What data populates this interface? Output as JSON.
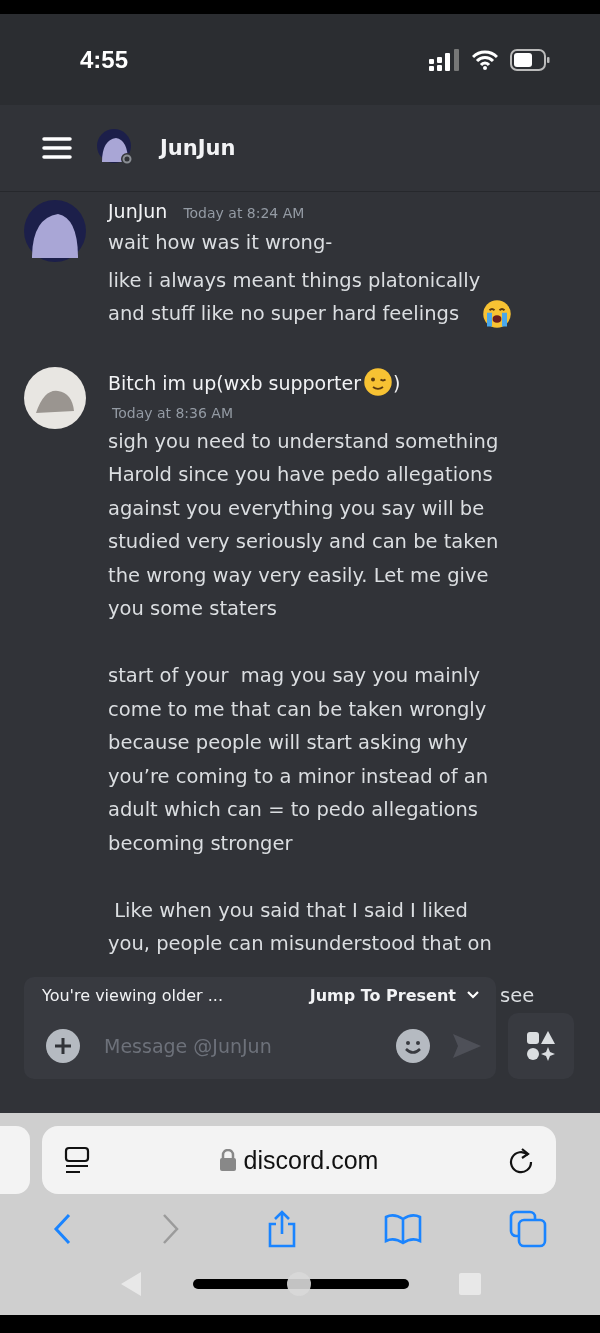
{
  "status_bar": {
    "time": "4:55"
  },
  "header": {
    "title": "JunJun"
  },
  "messages": [
    {
      "author_parts": [
        {
          "kind": "text",
          "text": "JunJun"
        }
      ],
      "timestamp": "Today at 8:24 AM",
      "timestamp_below": false,
      "paragraphs": [
        {
          "text": "wait how was it wrong-"
        },
        {
          "text": "like i always meant things platonically\nand stuff like no super hard feelings",
          "trailing": [
            {
              "kind": "crying"
            }
          ]
        }
      ]
    },
    {
      "author_parts": [
        {
          "kind": "text",
          "text": "Bitch im up(wxb supporter"
        },
        {
          "kind": "wink"
        },
        {
          "kind": "text",
          "text": ")"
        }
      ],
      "timestamp": "Today at 8:36 AM",
      "timestamp_below": true,
      "paragraphs": [
        {
          "text": "sigh you need to understand something\nHarold since you have pedo allegations\nagainst you everything you say will be\nstudied very seriously and can be taken\nthe wrong way very easily. Let me give\nyou some staters\n\nstart of your  mag you say you mainly\ncome to me that can be taken wrongly\nbecause people will start asking why\nyou’re coming to a minor instead of an\nadult which can = to pedo allegations\nbecoming stronger\n\n Like when you said that I said I liked\nyou, people can misunderstood that on"
        }
      ]
    }
  ],
  "older_banner": {
    "text": "You're viewing older ...",
    "action": "Jump To Present",
    "peek_text": "see"
  },
  "composer": {
    "placeholder": "Message @JunJun"
  },
  "browser": {
    "url": "discord.com"
  }
}
